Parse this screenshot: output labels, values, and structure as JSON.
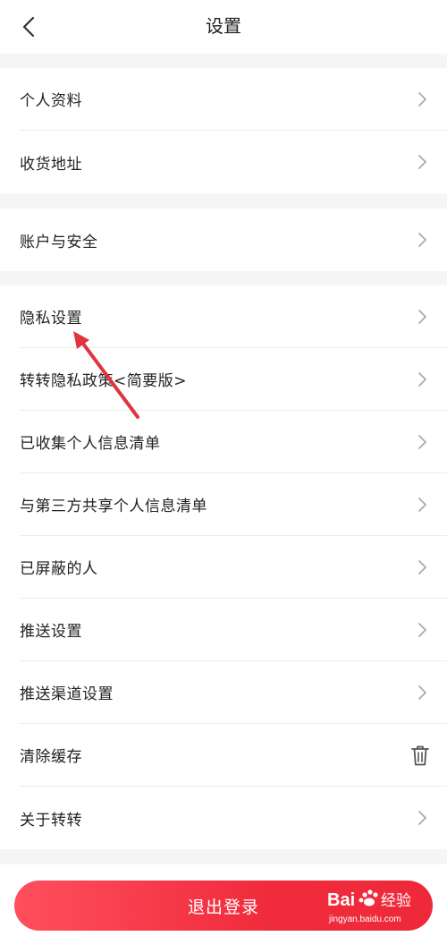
{
  "header": {
    "title": "设置",
    "back_icon": "chevron-left-icon"
  },
  "sections": [
    {
      "items": [
        {
          "label": "个人资料",
          "icon": "chevron-right-icon"
        },
        {
          "label": "收货地址",
          "icon": "chevron-right-icon"
        }
      ]
    },
    {
      "items": [
        {
          "label": "账户与安全",
          "icon": "chevron-right-icon"
        }
      ]
    },
    {
      "items": [
        {
          "label": "隐私设置",
          "icon": "chevron-right-icon"
        },
        {
          "label": "转转隐私政策<简要版>",
          "icon": "chevron-right-icon"
        },
        {
          "label": "已收集个人信息清单",
          "icon": "chevron-right-icon"
        },
        {
          "label": "与第三方共享个人信息清单",
          "icon": "chevron-right-icon"
        },
        {
          "label": "已屏蔽的人",
          "icon": "chevron-right-icon"
        },
        {
          "label": "推送设置",
          "icon": "chevron-right-icon"
        },
        {
          "label": "推送渠道设置",
          "icon": "chevron-right-icon"
        },
        {
          "label": "清除缓存",
          "icon": "trash-icon"
        },
        {
          "label": "关于转转",
          "icon": "chevron-right-icon"
        }
      ]
    }
  ],
  "footer": {
    "logout_label": "退出登录"
  },
  "watermark": {
    "brand": "Bai 经验",
    "url": "jingyan.baidu.com"
  },
  "colors": {
    "accent": "#f02b3c",
    "annotation_arrow": "#e0353f",
    "separator": "#f5f5f5"
  }
}
